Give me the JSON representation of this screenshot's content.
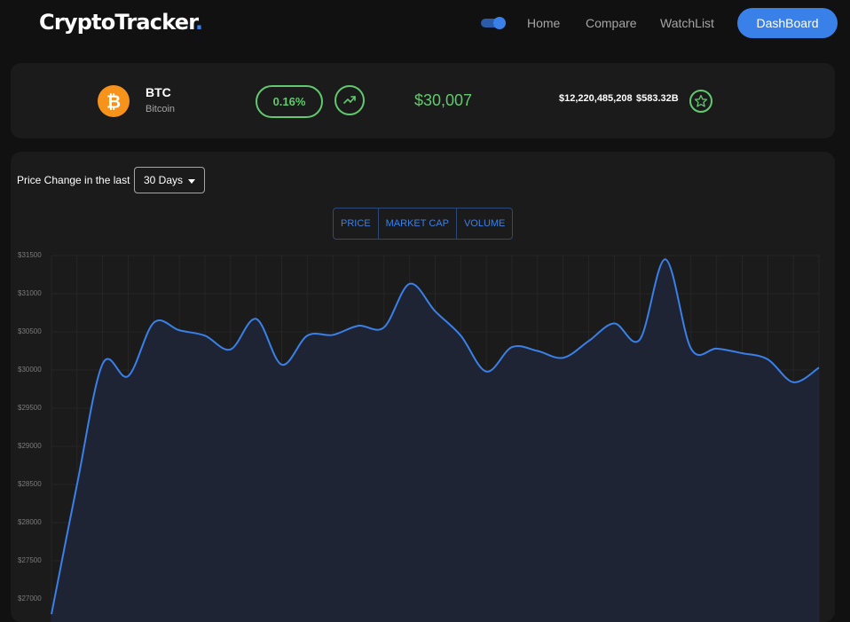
{
  "header": {
    "logo_text": "CryptoTracker",
    "logo_dot": ".",
    "nav": [
      "Home",
      "Compare",
      "WatchList"
    ],
    "dashboard_label": "DashBoard"
  },
  "coin": {
    "symbol": "BTC",
    "name": "Bitcoin",
    "price_change_pct": "0.16%",
    "current_price": "$30,007",
    "total_volume": "$12,220,485,208",
    "market_cap": "$583.32B",
    "trend": "up",
    "icon": "bitcoin-icon"
  },
  "controls": {
    "period_label": "Price Change in the last",
    "period_value": "30 Days",
    "toggle_options": [
      "PRICE",
      "MARKET CAP",
      "VOLUME"
    ],
    "selected_toggle": "PRICE"
  },
  "colors": {
    "accent": "#3a80e9",
    "green": "#61c96f",
    "background": "#111111",
    "card": "#1b1b1b",
    "coin_orange": "#f7931a"
  },
  "chart_data": {
    "type": "area",
    "title": "",
    "xlabel": "",
    "ylabel": "",
    "y_ticks": [
      "$31500",
      "$31000",
      "$30500",
      "$30000",
      "$29500",
      "$29000",
      "$28500",
      "$28000",
      "$27500",
      "$27000"
    ],
    "ylim": [
      27000,
      31500
    ],
    "grid": true,
    "series": [
      {
        "values": [
          26800,
          28500,
          30080,
          29920,
          30620,
          30520,
          30450,
          30270,
          30670,
          30070,
          30450,
          30460,
          30580,
          30560,
          31130,
          30770,
          30450,
          29980,
          30300,
          30250,
          30160,
          30380,
          30610,
          30400,
          31450,
          30280,
          30280,
          30220,
          30140,
          29840,
          30030
        ]
      }
    ]
  }
}
